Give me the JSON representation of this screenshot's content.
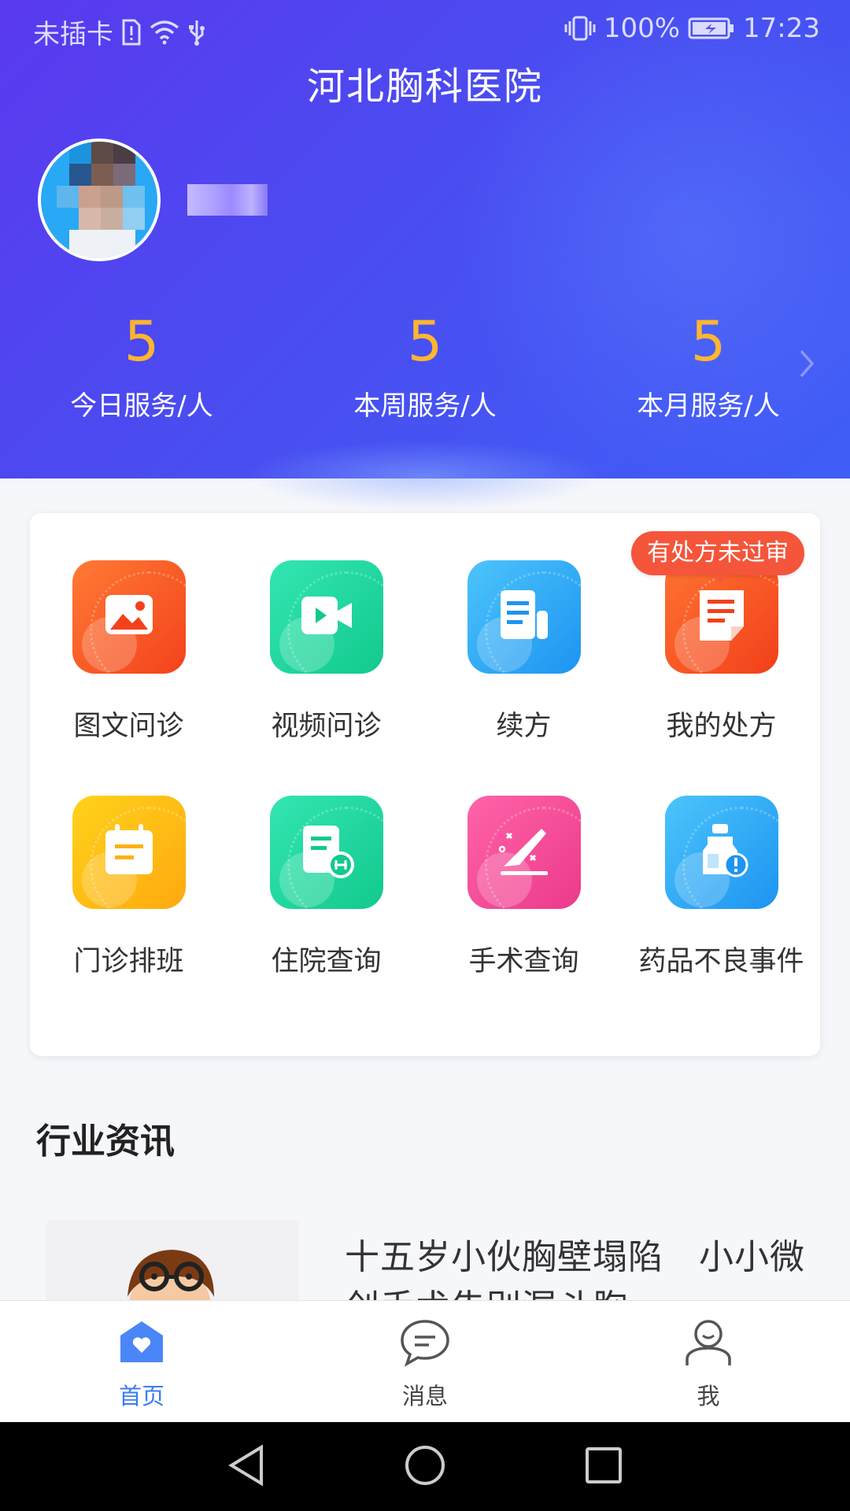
{
  "status_bar": {
    "carrier": "未插卡",
    "battery": "100%",
    "time": "17:23"
  },
  "header": {
    "hospital_name": "河北胸科医院"
  },
  "stats": [
    {
      "value": "5",
      "label": "今日服务/人"
    },
    {
      "value": "5",
      "label": "本周服务/人"
    },
    {
      "value": "5",
      "label": "本月服务/人"
    }
  ],
  "functions": [
    {
      "label": "图文问诊",
      "icon": "image-consult-icon",
      "color": "#f5541f"
    },
    {
      "label": "视频问诊",
      "icon": "video-consult-icon",
      "color": "#1bd8a0"
    },
    {
      "label": "续方",
      "icon": "renew-prescription-icon",
      "color": "#2eaaf7"
    },
    {
      "label": "我的处方",
      "icon": "my-prescription-icon",
      "color": "#f64e1d"
    },
    {
      "label": "门诊排班",
      "icon": "schedule-icon",
      "color": "#ffbd1a"
    },
    {
      "label": "住院查询",
      "icon": "inpatient-query-icon",
      "color": "#1bd8a0"
    },
    {
      "label": "手术查询",
      "icon": "surgery-query-icon",
      "color": "#f64c9c"
    },
    {
      "label": "药品不良事件",
      "icon": "drug-adverse-event-icon",
      "color": "#2eaaf7"
    }
  ],
  "badge": "有处方未过审",
  "news": {
    "section_title": "行业资讯",
    "items": [
      {
        "title": "十五岁小伙胸壁塌陷　小小微创手术告别漏斗胸"
      }
    ]
  },
  "tabs": [
    {
      "label": "首页",
      "icon": "home-icon",
      "active": true
    },
    {
      "label": "消息",
      "icon": "message-icon",
      "active": false
    },
    {
      "label": "我",
      "icon": "profile-icon",
      "active": false
    }
  ],
  "colors": {
    "header_start": "#5a39ef",
    "header_end": "#3f5ef6",
    "stat_number": "#ffb531",
    "tab_active": "#3b7bf5",
    "badge": "#f4553b"
  }
}
